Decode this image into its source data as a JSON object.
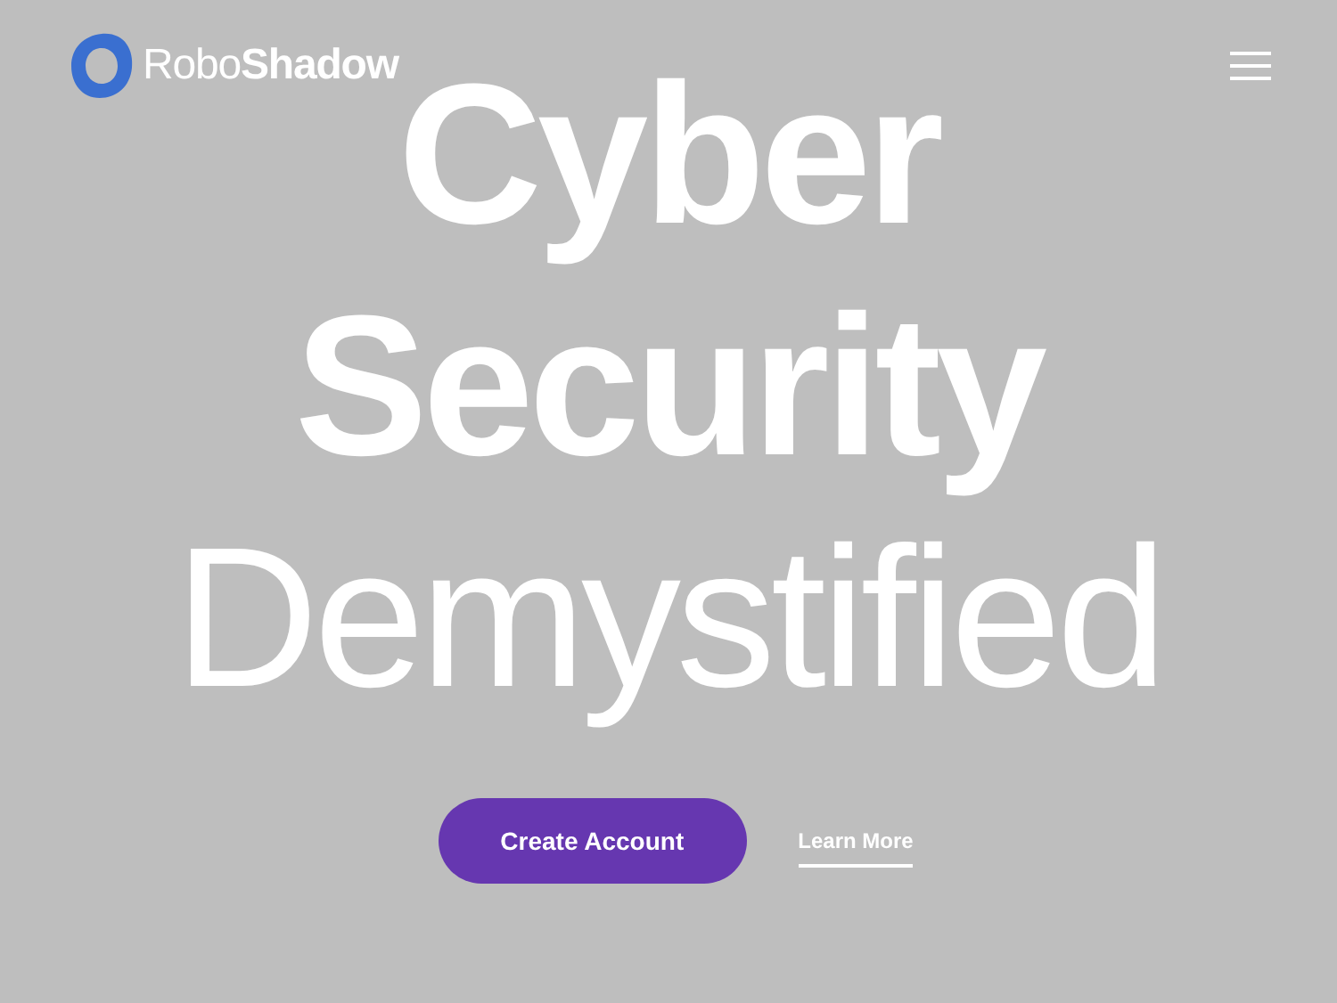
{
  "header": {
    "logo": "Robo**Shadow**"
  },
  "hero": {
    "lines": [
      {
        "text": "Cyber",
        "kind": "bold"
      },
      {
        "text": "Security",
        "kind": "bold"
      },
      {
        "text": "Demystified",
        "kind": "light"
      }
    ]
  },
  "actions": {
    "primary": "Create Account",
    "secondary": "Learn More"
  }
}
